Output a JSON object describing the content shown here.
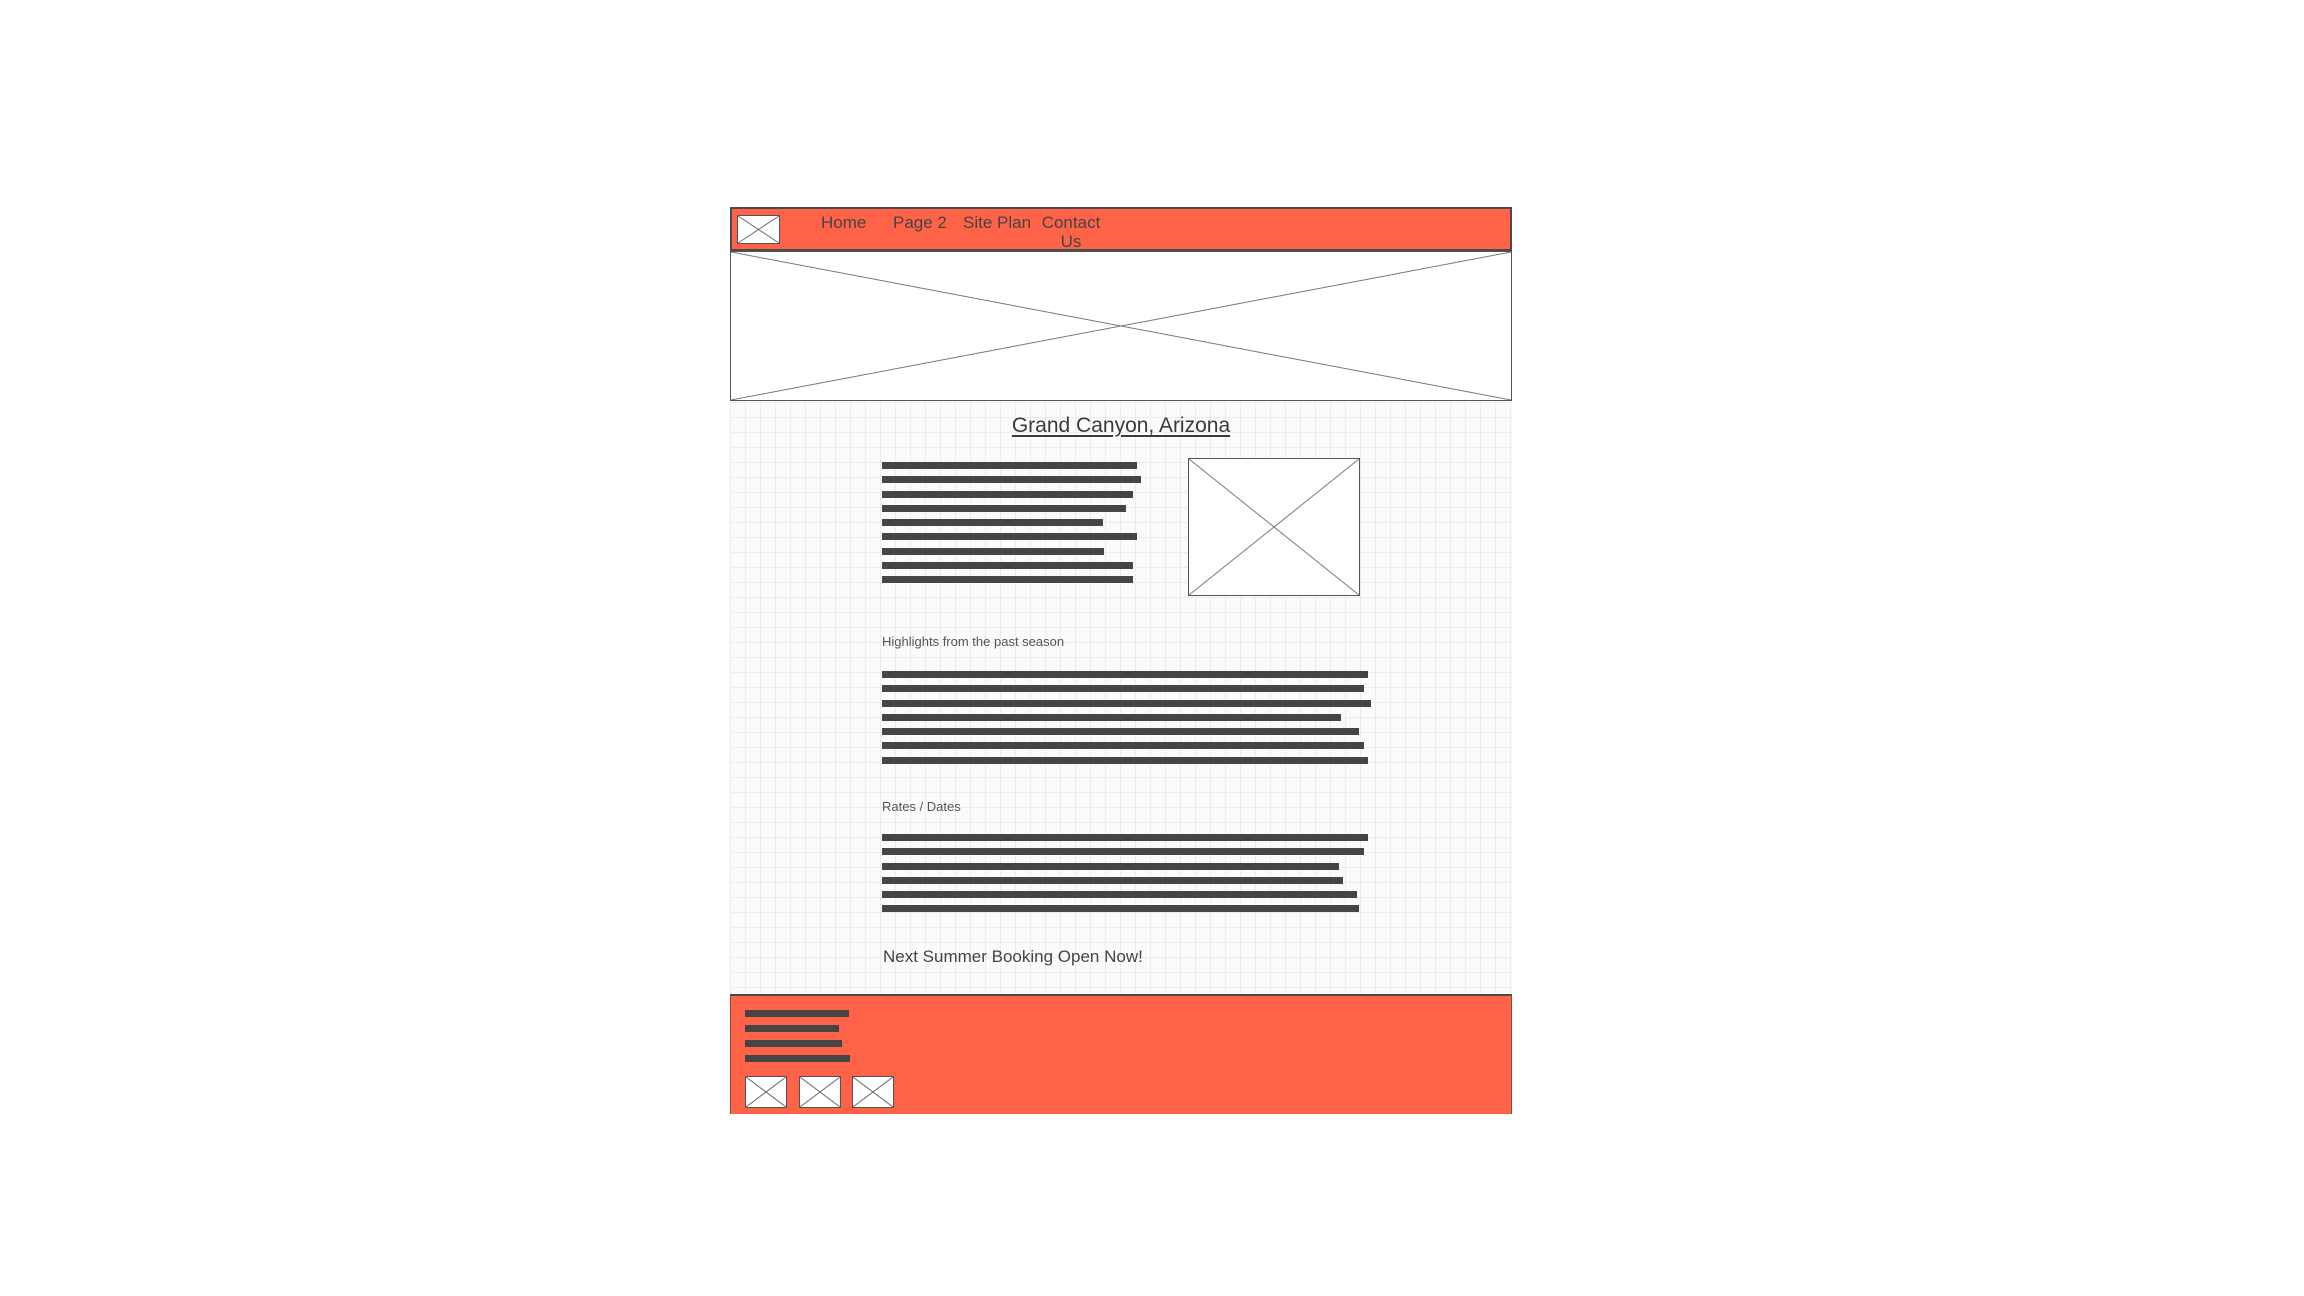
{
  "nav": {
    "items": [
      {
        "label": "Home"
      },
      {
        "label": "Page 2"
      },
      {
        "label": "Site Plan"
      },
      {
        "label": "Contact\nUs"
      }
    ]
  },
  "main": {
    "title": "Grand Canyon, Arizona",
    "sections": [
      {
        "label": "Highlights from the past season"
      },
      {
        "label": "Rates / Dates"
      }
    ],
    "cta": "Next Summer Booking Open Now!"
  },
  "colors": {
    "accent": "#ff6347",
    "text_bar": "#454545",
    "grid": "#ececec"
  },
  "icons": {
    "logo": "image-placeholder-icon",
    "hero": "image-placeholder-icon",
    "intro_image": "image-placeholder-icon",
    "footer_social": [
      "image-placeholder-icon",
      "image-placeholder-icon",
      "image-placeholder-icon"
    ]
  }
}
